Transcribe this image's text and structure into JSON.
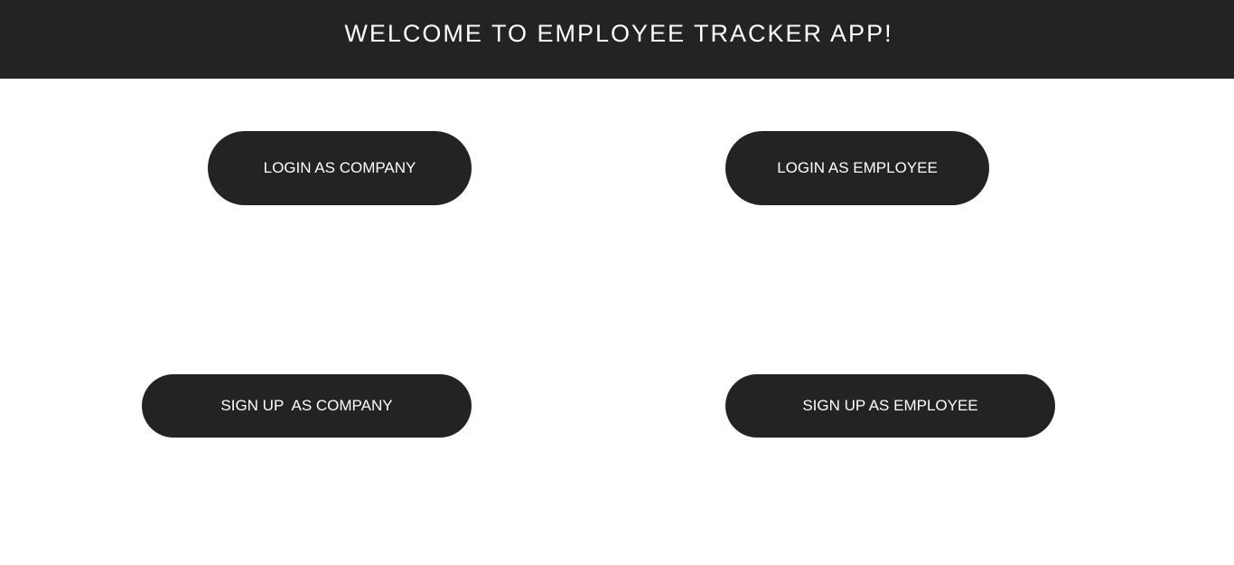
{
  "header": {
    "title": "WELCOME TO EMPLOYEE TRACKER APP!"
  },
  "buttons": {
    "login_company": "LOGIN AS COMPANY",
    "login_employee": "LOGIN AS EMPLOYEE",
    "signup_company": "SIGN UP  AS COMPANY",
    "signup_employee": "SIGN UP AS EMPLOYEE"
  },
  "colors": {
    "header_bg": "#232323",
    "button_bg": "#232323",
    "button_text": "#ffffff",
    "page_bg": "#ffffff"
  }
}
